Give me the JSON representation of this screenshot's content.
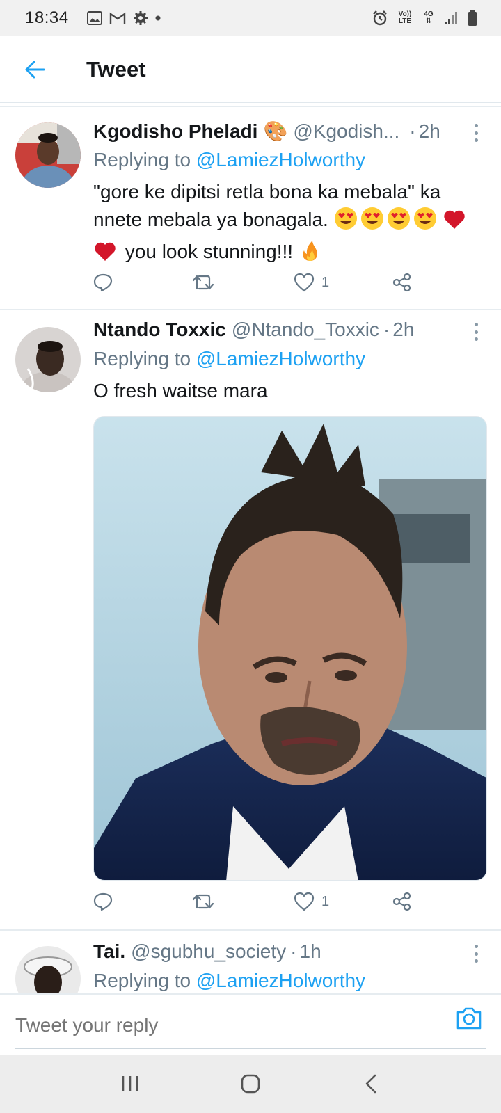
{
  "status_bar": {
    "time": "18:34",
    "volte": "Vo)) LTE",
    "network": "4G"
  },
  "header": {
    "title": "Tweet"
  },
  "tweets": [
    {
      "name": "Kgodisho Pheladi",
      "name_emoji": "🎨",
      "handle": "@Kgodish...",
      "separator": "·",
      "time": "2h",
      "replying_prefix": "Replying to",
      "replying_to": "@LamiezHolworthy",
      "text_line1": "\"gore ke dipitsi retla bona ka mebala\" ka",
      "text_line2": "nnete mebala ya bonagala.",
      "text_line3": "you look stunning!!!",
      "replies": "",
      "retweets": "",
      "likes": "1"
    },
    {
      "name": "Ntando Toxxic",
      "handle": "@Ntando_Toxxic",
      "separator": "·",
      "time": "2h",
      "replying_prefix": "Replying to",
      "replying_to": "@LamiezHolworthy",
      "text": "O fresh waitse mara",
      "likes": "1"
    },
    {
      "name": "Tai.",
      "handle": "@sgubhu_society",
      "separator": "·",
      "time": "1h",
      "replying_prefix": "Replying to",
      "replying_to": "@LamiezHolworthy"
    }
  ],
  "reply_bar": {
    "placeholder": "Tweet your reply"
  },
  "colors": {
    "accent": "#1da1f2",
    "secondary_text": "#657786"
  }
}
